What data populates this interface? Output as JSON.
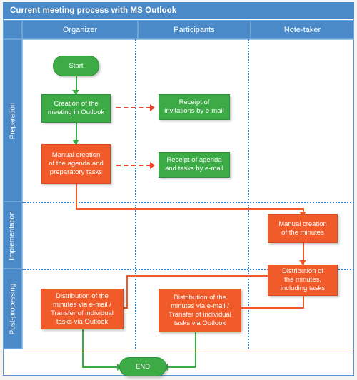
{
  "diagram": {
    "title": "Current meeting process with MS Outlook",
    "columns": [
      {
        "id": "organizer",
        "label": "Organizer"
      },
      {
        "id": "participants",
        "label": "Participants"
      },
      {
        "id": "notetaker",
        "label": "Note-taker"
      }
    ],
    "lanes": [
      {
        "id": "preparation",
        "label": "Preparation"
      },
      {
        "id": "implementation",
        "label": "Implementation"
      },
      {
        "id": "postprocessing",
        "label": "Post-processing"
      }
    ],
    "nodes": {
      "start": "Start",
      "create_meeting": "Creation of the\nmeeting in Outlook",
      "receipt_invitations": "Receipt of\ninvitations by e-mail",
      "manual_agenda": "Manual creation\nof the agenda and\npreparatory tasks",
      "receipt_agenda": "Receipt of agenda\nand tasks by e-mail",
      "manual_minutes": "Manual creation\nof the minutes",
      "distribute_minutes": "Distribution of\nthe minutes,\nincluding tasks",
      "dist_organizer": "Distribution of the\nminutes via e-mail /\nTransfer of individual\ntasks via Outlook",
      "dist_participants": "Distribution of the\nminutes via e-mail /\nTransfer of individual\ntasks via Outlook",
      "end": "END"
    },
    "colors": {
      "header_blue": "#4a8ac8",
      "lane_blue": "#4a8ac8",
      "grid_blue": "#2f7fd0",
      "green": "#3cab46",
      "orange": "#f15a29",
      "dashed_red": "#f1412b",
      "background": "#ffffff"
    }
  }
}
